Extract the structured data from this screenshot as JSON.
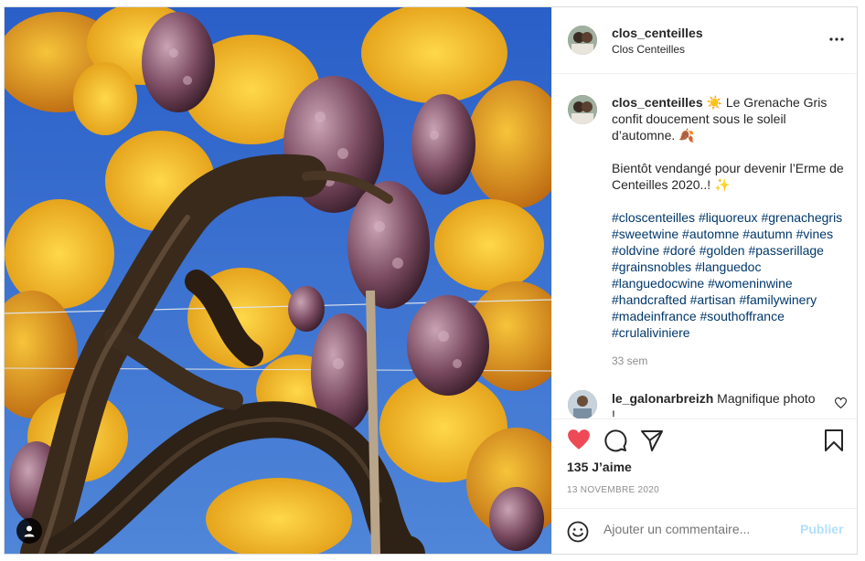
{
  "post": {
    "username": "clos_centeilles",
    "location": "Clos Centeilles"
  },
  "caption": {
    "username": "clos_centeilles",
    "line1": "☀️ Le Grenache Gris confit doucement sous le soleil d’automne. 🍂",
    "line2": "Bientôt vendangé pour devenir l’Erme de Centeilles 2020..! ✨",
    "hashtags": [
      "#closcenteilles",
      "#liquoreux",
      "#grenachegris",
      "#sweetwine",
      "#automne",
      "#autumn",
      "#vines",
      "#oldvine",
      "#doré",
      "#golden",
      "#passerillage",
      "#grainsnobles",
      "#languedoc",
      "#languedocwine",
      "#womeninwine",
      "#handcrafted",
      "#artisan",
      "#familywinery",
      "#madeinfrance",
      "#southoffrance",
      "#crulaliviniere"
    ],
    "age": "33 sem"
  },
  "comment": {
    "username": "le_galonarbreizh",
    "text": "Magnifique photo !"
  },
  "stats": {
    "likes": "135 J’aime",
    "date": "13 NOVEMBRE 2020"
  },
  "add_comment": {
    "placeholder": "Ajouter un commentaire...",
    "publish": "Publier"
  },
  "icons": {
    "like": "heart-filled-icon",
    "comment": "comment-icon",
    "share": "paper-plane-icon",
    "save": "bookmark-icon",
    "more": "more-horizontal-icon",
    "emoji": "emoji-smile-icon",
    "user_tag": "user-tag-icon"
  },
  "colors": {
    "like": "#ed4956",
    "hashtag": "#00376b",
    "muted": "#8e8e8e",
    "publish_disabled": "#b2dffc"
  }
}
